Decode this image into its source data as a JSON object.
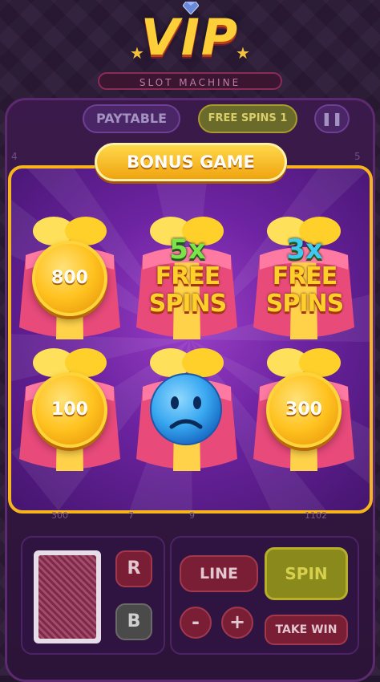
{
  "header": {
    "logo_text": "VIP",
    "subtitle": "SLOT MACHINE",
    "star": "★"
  },
  "topbar": {
    "paytable": "PAYTABLE",
    "free_spins": "FREE SPINS 1",
    "pause": "❚❚"
  },
  "side_numbers": [
    "4",
    "5"
  ],
  "bonus": {
    "title": "BONUS GAME",
    "cells": [
      {
        "type": "coin",
        "value": "800"
      },
      {
        "type": "free_spins",
        "multiplier": "5x",
        "line1": "FREE",
        "line2": "SPINS",
        "mult_color": "#7de34a"
      },
      {
        "type": "free_spins",
        "multiplier": "3x",
        "line1": "FREE",
        "line2": "SPINS",
        "mult_color": "#3fc8f0"
      },
      {
        "type": "coin",
        "value": "100"
      },
      {
        "type": "sad_face",
        "icon": "sad-face-icon"
      },
      {
        "type": "coin",
        "value": "300"
      }
    ]
  },
  "line_labels": [
    "300",
    "7",
    "9",
    "1102"
  ],
  "controls": {
    "r": "R",
    "b": "B",
    "line": "LINE",
    "spin": "SPIN",
    "minus": "-",
    "plus": "+",
    "take_win": "TAKE WIN"
  }
}
